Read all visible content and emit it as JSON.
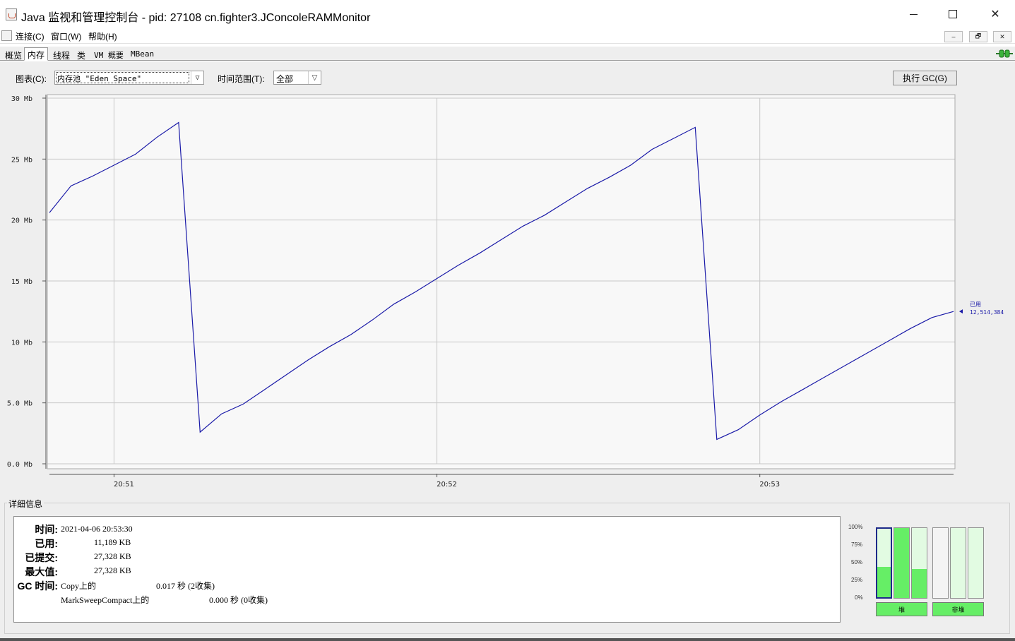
{
  "window": {
    "title": "Java 监视和管理控制台 - pid: 27108 cn.fighter3.JConcoleRAMMonitor",
    "minimize_glyph": "",
    "maximize_glyph": "",
    "close_glyph": "✕"
  },
  "menu": {
    "items": [
      "连接(C)",
      "窗口(W)",
      "帮助(H)"
    ],
    "mdi_buttons": [
      "–",
      "🗗",
      "✕"
    ]
  },
  "tabs": [
    "概览",
    "内存",
    "线程",
    "类",
    "VM 概要",
    "MBean"
  ],
  "active_tab": "内存",
  "controls": {
    "chart_label": "图表(C):",
    "chart_value": "内存池 \"Eden Space\"",
    "range_label": "时间范围(T):",
    "range_value": "全部",
    "gc_button": "执行 GC(G)"
  },
  "chart_data": {
    "type": "line",
    "x_ticks": [
      "20:51",
      "20:52",
      "20:53"
    ],
    "y_ticks": [
      "0.0 Mb",
      "5.0 Mb",
      "10 Mb",
      "15 Mb",
      "20 Mb",
      "25 Mb",
      "30 Mb"
    ],
    "ylim": [
      0,
      30
    ],
    "x_unit": "seconds after 20:50:48",
    "series": [
      {
        "name": "已用",
        "color": "#1a1aa8",
        "value_label": "12,514,384",
        "x": [
          0,
          4,
          8,
          12,
          16,
          20,
          24,
          28,
          32,
          36,
          40,
          44,
          48,
          52,
          56,
          60,
          64,
          68,
          72,
          76,
          80,
          84,
          88,
          92,
          96,
          100,
          104,
          108,
          112,
          116,
          120,
          124,
          128,
          132,
          136,
          140,
          144,
          148,
          152,
          156,
          160,
          164,
          168
        ],
        "y": [
          20.6,
          22.8,
          23.6,
          24.5,
          25.4,
          26.8,
          28.0,
          2.6,
          4.1,
          4.9,
          6.1,
          7.3,
          8.5,
          9.6,
          10.6,
          11.8,
          13.1,
          14.1,
          15.2,
          16.3,
          17.3,
          18.4,
          19.5,
          20.4,
          21.5,
          22.6,
          23.5,
          24.5,
          25.8,
          26.7,
          27.6,
          2.0,
          2.8,
          4.0,
          5.1,
          6.1,
          7.1,
          8.1,
          9.1,
          10.1,
          11.1,
          12.0,
          12.5
        ]
      }
    ],
    "grid": true,
    "legend_position": "right"
  },
  "details": {
    "title": "详细信息",
    "rows": [
      {
        "label": "时间:",
        "value": "2021-04-06 20:53:30"
      },
      {
        "label": "已用:",
        "value": "11,189 KB"
      },
      {
        "label": "已提交:",
        "value": "27,328 KB"
      },
      {
        "label": "最大值:",
        "value": "27,328 KB"
      }
    ],
    "gc_label": "GC 时间:",
    "gc_rows": [
      {
        "name": "Copy上的",
        "value": "0.017 秒 (2收集)"
      },
      {
        "name": "MarkSweepCompact上的",
        "value": "0.000 秒 (0收集)"
      }
    ]
  },
  "bars": {
    "scale": [
      "100%",
      "75%",
      "50%",
      "25%",
      "0%"
    ],
    "heap_label": "堆",
    "nonheap_label": "非堆",
    "heap": [
      {
        "used": 0.44,
        "committed": 1.0,
        "selected": true
      },
      {
        "used": 1.0,
        "committed": 1.0,
        "selected": false
      },
      {
        "used": 0.41,
        "committed": 1.0,
        "selected": false
      }
    ],
    "nonheap": [
      {
        "used": 0.0,
        "committed": 1.0,
        "selected": false,
        "bg": "#f4f4f4"
      },
      {
        "used": 0.0,
        "committed": 1.0,
        "selected": false,
        "bg": "#e2fbe2"
      },
      {
        "used": 0.0,
        "committed": 1.0,
        "selected": false,
        "bg": "#e2fbe2"
      }
    ]
  }
}
